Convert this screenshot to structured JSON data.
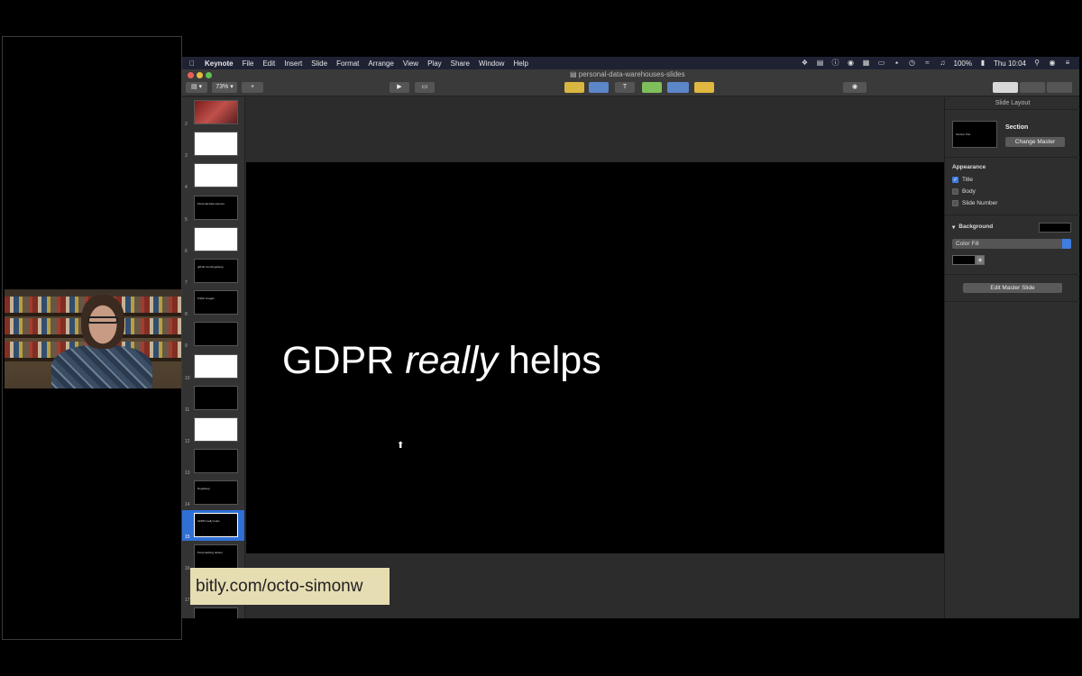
{
  "menubar": {
    "app": "Keynote",
    "items": [
      "File",
      "Edit",
      "Insert",
      "Slide",
      "Format",
      "Arrange",
      "View",
      "Play",
      "Share",
      "Window",
      "Help"
    ],
    "battery": "100%",
    "clock": "Thu 10:04"
  },
  "window": {
    "title": "personal-data-warehouses-slides",
    "zoom": "73%"
  },
  "navigator": {
    "slides": [
      {
        "num": "2",
        "text": "",
        "style": "photo"
      },
      {
        "num": "3",
        "text": "",
        "style": "white"
      },
      {
        "num": "4",
        "text": "",
        "style": "white"
      },
      {
        "num": "5",
        "text": "Personal data sources",
        "style": "dark"
      },
      {
        "num": "6",
        "text": "",
        "style": "white"
      },
      {
        "num": "7",
        "text": "github.com/dogsheep",
        "style": "dark"
      },
      {
        "num": "8",
        "text": "Public images",
        "style": "dark"
      },
      {
        "num": "9",
        "text": "",
        "style": "dark"
      },
      {
        "num": "10",
        "text": "",
        "style": "white"
      },
      {
        "num": "11",
        "text": "",
        "style": "dark"
      },
      {
        "num": "12",
        "text": "",
        "style": "white"
      },
      {
        "num": "13",
        "text": "",
        "style": "dark"
      },
      {
        "num": "14",
        "text": "Dogsheep",
        "style": "dark"
      },
      {
        "num": "15",
        "text": "GDPR really helps",
        "style": "dark",
        "selected": true
      },
      {
        "num": "16",
        "text": "Personalizing docker",
        "style": "dark"
      },
      {
        "num": "17",
        "text": "",
        "style": "dark"
      },
      {
        "num": "18",
        "text": "",
        "style": "dark"
      }
    ]
  },
  "slide": {
    "title_pre": "GDPR ",
    "title_em": "really",
    "title_post": " helps"
  },
  "inspector": {
    "header": "Slide Layout",
    "master_thumb_text": "Section Title",
    "section_label": "Section",
    "change_master": "Change Master",
    "appearance_label": "Appearance",
    "checkboxes": [
      {
        "label": "Title",
        "checked": true
      },
      {
        "label": "Body",
        "checked": false
      },
      {
        "label": "Slide Number",
        "checked": false
      }
    ],
    "background_label": "Background",
    "fill_type": "Color Fill",
    "edit_master": "Edit Master Slide"
  },
  "banner": {
    "url": "bitly.com/octo-simonw"
  }
}
